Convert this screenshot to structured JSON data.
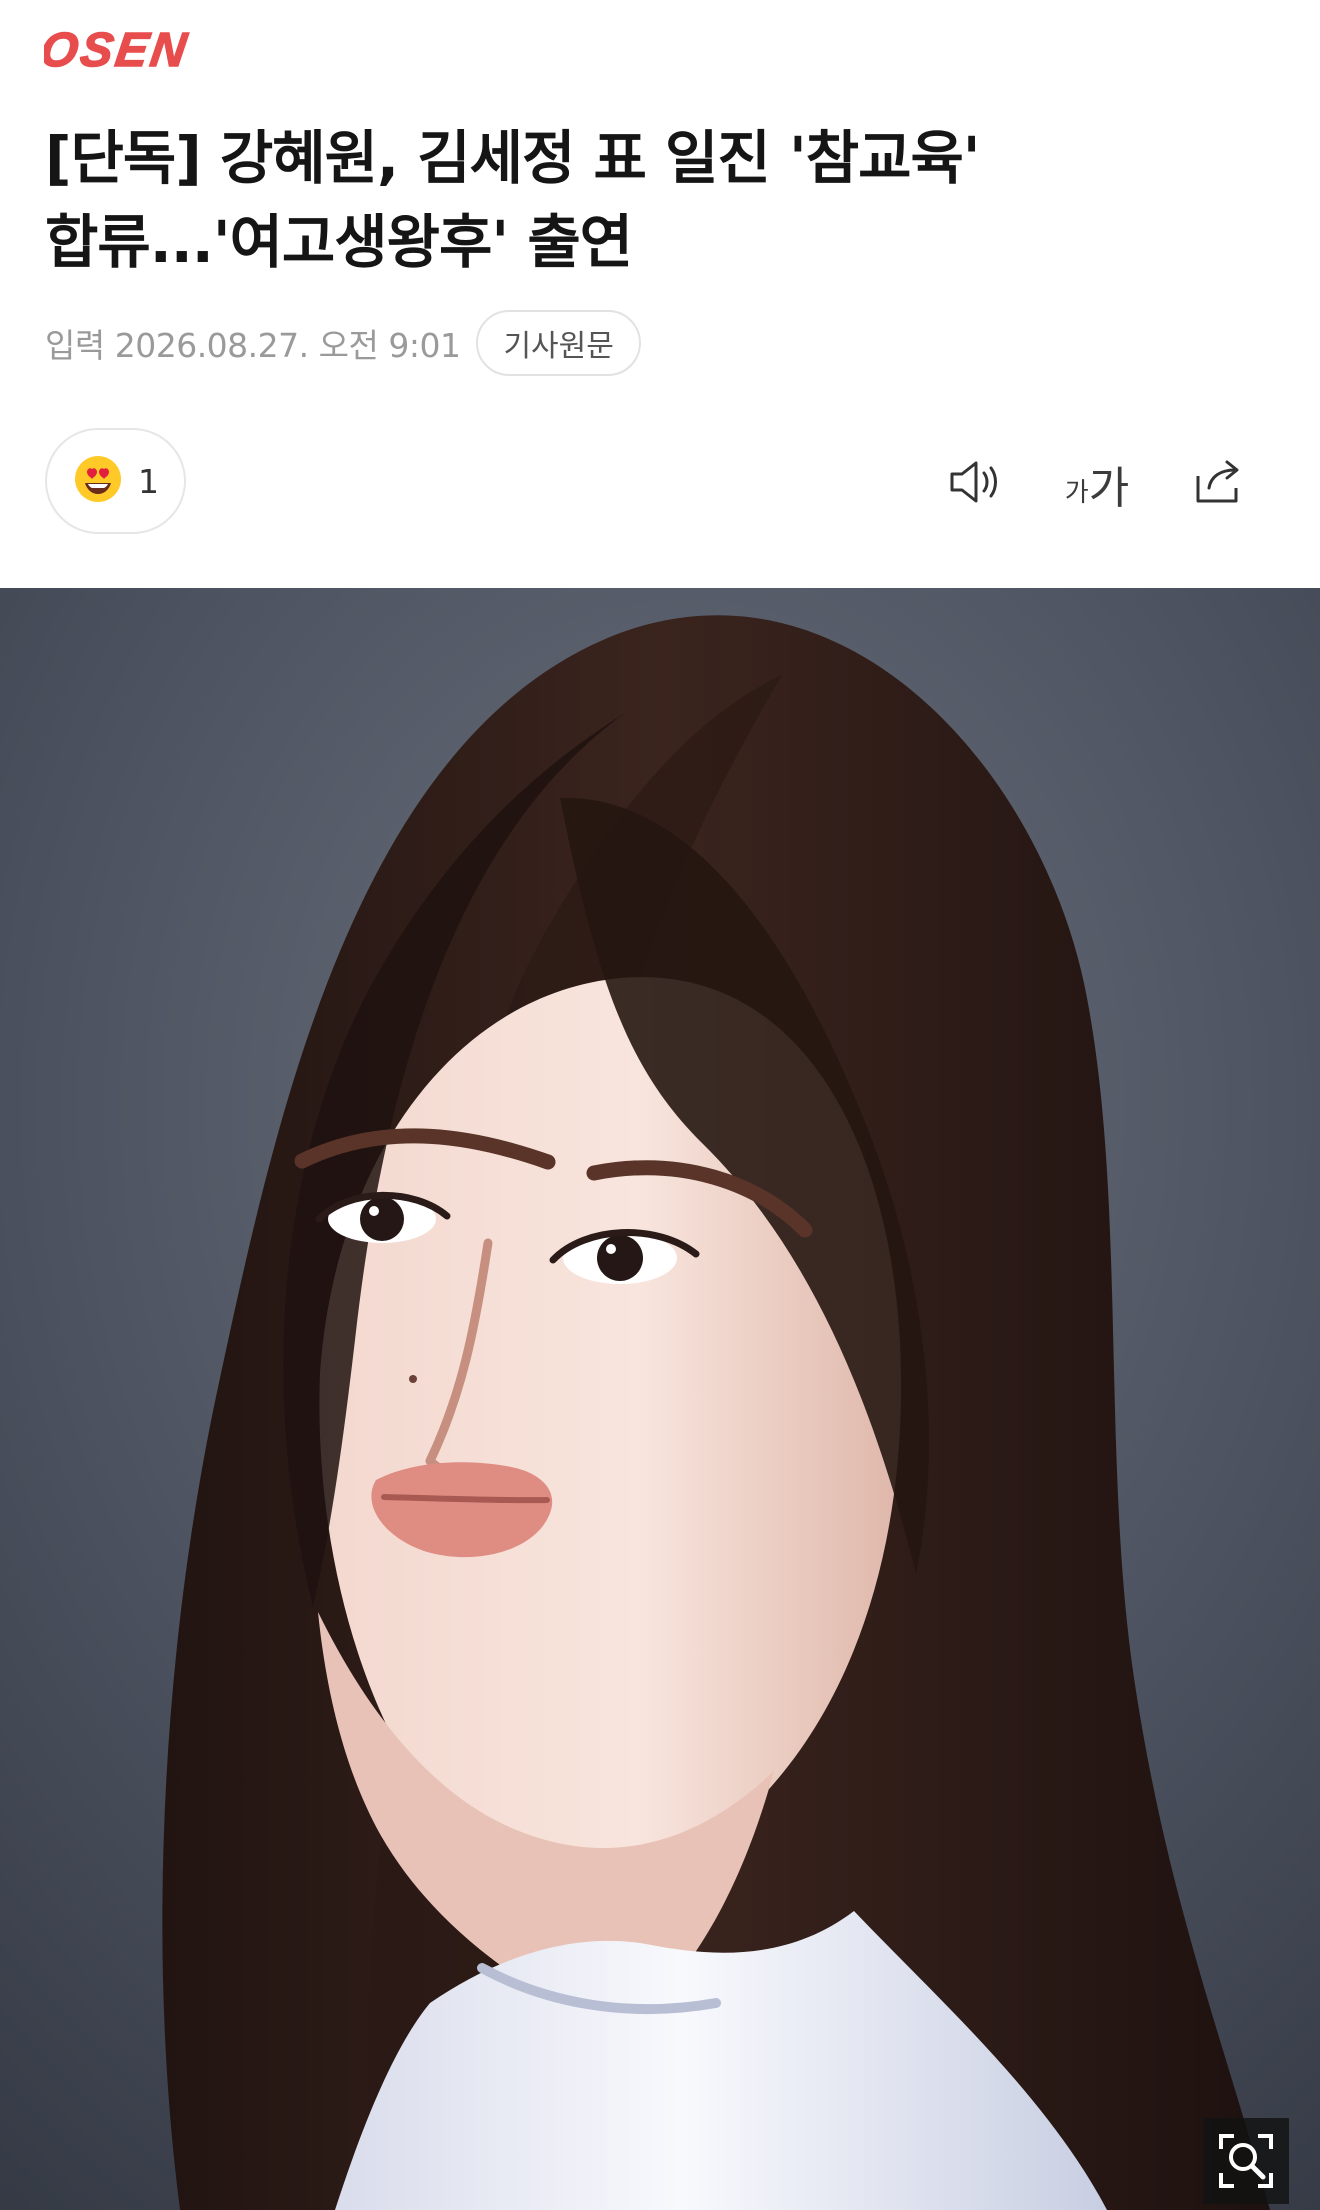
{
  "brand": {
    "logo_text": "OSEN",
    "logo_color": "#e84d4d",
    "accent_color": "#e84d4d"
  },
  "article": {
    "headline": "[단독] 강혜원, 김세정 표 일진 '참교육' 합류...'여고생왕후' 출연",
    "published": "입력 2026.08.27. 오전 9:01",
    "source_button_label": "기사원문"
  },
  "actions": {
    "reaction_icon": "heart-eyes-emoji-icon",
    "reaction_count": "1",
    "audio_icon": "speaker-icon",
    "font_size_small": "가",
    "font_size_large": "가",
    "share_icon": "share-icon"
  },
  "photo": {
    "description_icon": "portrait-photo",
    "zoom_icon": "magnify-fullscreen-icon"
  }
}
